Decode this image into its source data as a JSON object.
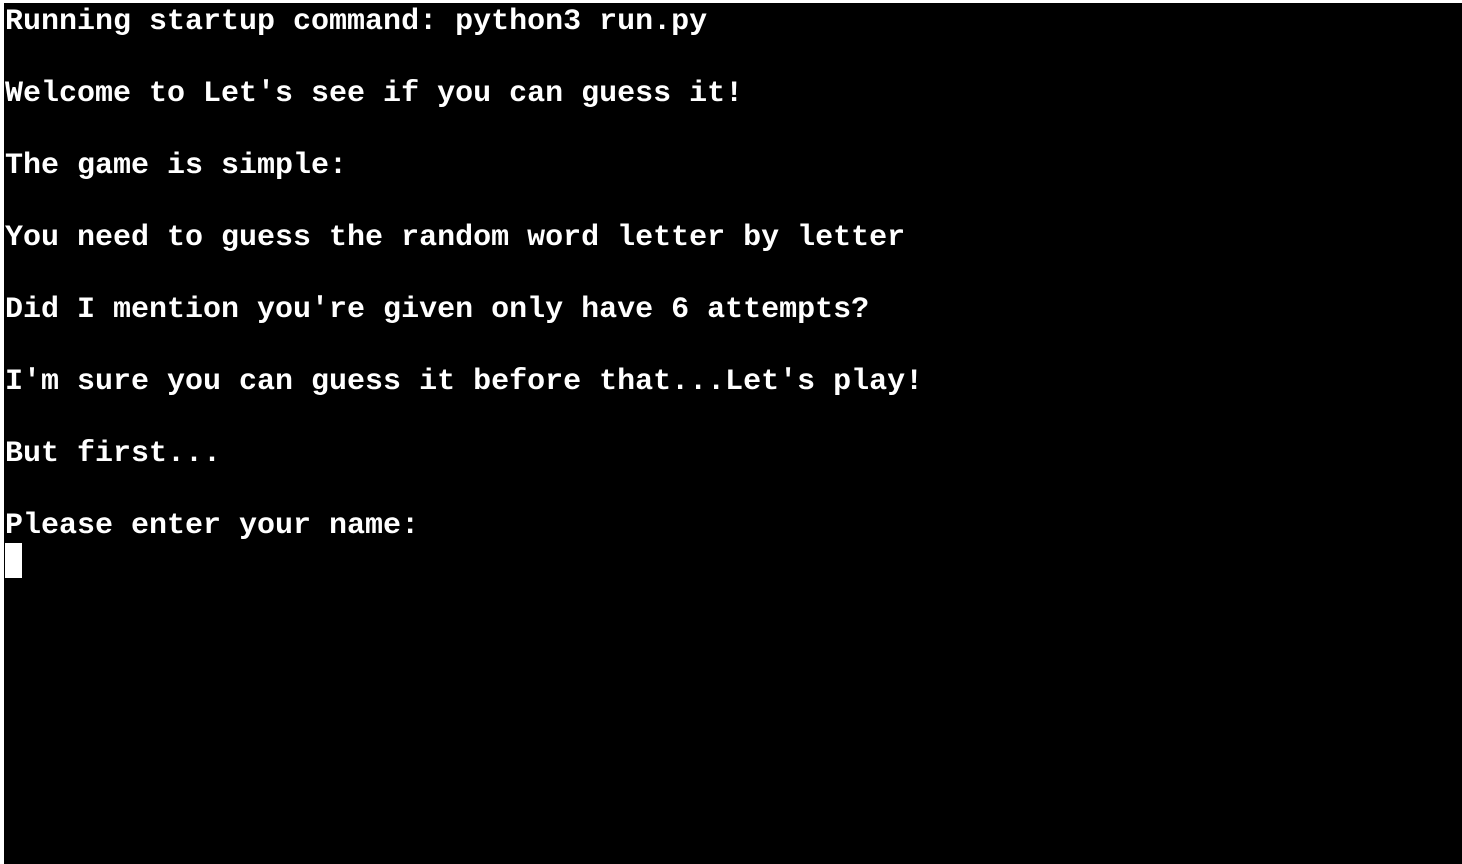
{
  "terminal": {
    "lines": [
      "Running startup command: python3 run.py",
      "Welcome to Let's see if you can guess it!",
      "The game is simple:",
      "You need to guess the random word letter by letter",
      "Did I mention you're given only have 6 attempts?",
      "I'm sure you can guess it before that...Let's play!",
      "But first...",
      "Please enter your name:"
    ],
    "input_value": ""
  },
  "colors": {
    "background": "#000000",
    "text": "#ffffff",
    "cursor": "#ffffff"
  }
}
